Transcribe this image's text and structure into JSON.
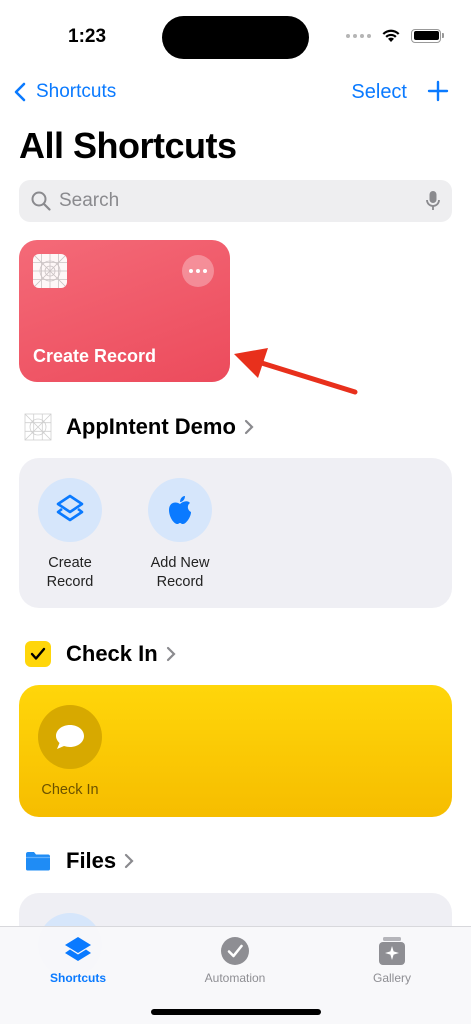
{
  "status": {
    "time": "1:23"
  },
  "nav": {
    "back_label": "Shortcuts",
    "select_label": "Select"
  },
  "page": {
    "title": "All Shortcuts"
  },
  "search": {
    "placeholder": "Search"
  },
  "featured_card": {
    "label": "Create Record",
    "color": "#ef5566"
  },
  "sections": {
    "appintent": {
      "title": "AppIntent Demo",
      "actions": [
        {
          "label": "Create\nRecord",
          "icon": "shortcuts-stack-icon"
        },
        {
          "label": "Add New\nRecord",
          "icon": "apple-icon"
        }
      ]
    },
    "checkin": {
      "title": "Check In",
      "actions": [
        {
          "label": "Check In",
          "icon": "message-bubble-icon"
        }
      ],
      "color": "#ffd60a"
    },
    "files": {
      "title": "Files"
    }
  },
  "tabbar": {
    "tabs": [
      {
        "label": "Shortcuts",
        "active": true
      },
      {
        "label": "Automation",
        "active": false
      },
      {
        "label": "Gallery",
        "active": false
      }
    ]
  },
  "colors": {
    "accent": "#0a7aff",
    "annotation_arrow": "#e8301c"
  }
}
